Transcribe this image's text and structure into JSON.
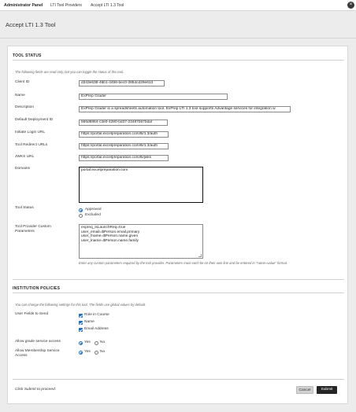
{
  "topbar": {
    "admin_panel": "Administrator Panel",
    "breadcrumb": [
      "LTI Tool Providers",
      "Accept LTI 1.3 Tool"
    ],
    "close_glyph": "×"
  },
  "page": {
    "title": "Accept LTI 1.3 Tool"
  },
  "tool_status": {
    "section_title": "TOOL STATUS",
    "note": "The following fields are read only, but you can toggle the status of this tool.",
    "fields": {
      "client_id": {
        "label": "Client ID",
        "value": "d343e638-46b1-4456-bec0-2854cd29e613"
      },
      "name": {
        "label": "Name",
        "value": "ExPrep Grader"
      },
      "description": {
        "label": "Description",
        "value": "ExPrep Grader is a spreadsheets automation tool. ExPrep LTI 1.3 tool supports Advantage services for integration w"
      },
      "deployment_id": {
        "label": "Default Deployment ID",
        "value": "566d6864-c3e0-4280-bd37-23487b67bdaf"
      },
      "initiate_login_url": {
        "label": "Initiate Login URL",
        "value": "https://portal.excelpreparation.com/lti/1.3/auth"
      },
      "tool_redirect_urls": {
        "label": "Tool Redirect URLs",
        "value": "https://portal.excelpreparation.com/lti/1.3/auth"
      },
      "jwks_url": {
        "label": "JWKS URL",
        "value": "https://portal.excelpreparation.com/lti/jwks"
      },
      "domains": {
        "label": "Domains",
        "value": "portal.excelpreparation.com"
      }
    },
    "tool_status": {
      "label": "Tool Status",
      "options": [
        {
          "label": "Approved",
          "selected": true
        },
        {
          "label": "Excluded",
          "selected": false
        }
      ]
    },
    "custom_params": {
      "label": "Tool Provider Custom Parameters",
      "value": "expreq_isLaunchReq=true\nuser_email=$Person.email.primary\nuser_fname=$Person.name.given\nuser_lname=$Person.name.family",
      "help": "Enter any custom parameters required by the tool provider. Parameters must each be on their own line and be entered in \"name=value\" format."
    }
  },
  "institution_policies": {
    "section_title": "INSTITUTION POLICIES",
    "note": "You can change the following settings for this tool. The fields use global values by default.",
    "user_fields": {
      "label": "User Fields to Send",
      "options": [
        {
          "label": "Role in Course",
          "checked": true
        },
        {
          "label": "Name",
          "checked": true
        },
        {
          "label": "Email Address",
          "checked": true
        }
      ]
    },
    "grade_service": {
      "label": "Allow grade service access",
      "options": [
        {
          "label": "Yes",
          "selected": true
        },
        {
          "label": "No",
          "selected": false
        }
      ]
    },
    "membership_service": {
      "label": "Allow Membership Service Access",
      "options": [
        {
          "label": "Yes",
          "selected": true
        },
        {
          "label": "No",
          "selected": false
        }
      ]
    }
  },
  "footer": {
    "hint": "Click Submit to proceed.",
    "cancel_label": "Cancel",
    "submit_label": "Submit"
  },
  "colors": {
    "accent": "#1a6fc4",
    "submit_bg": "#262626",
    "cancel_bg": "#d2d2d2"
  }
}
